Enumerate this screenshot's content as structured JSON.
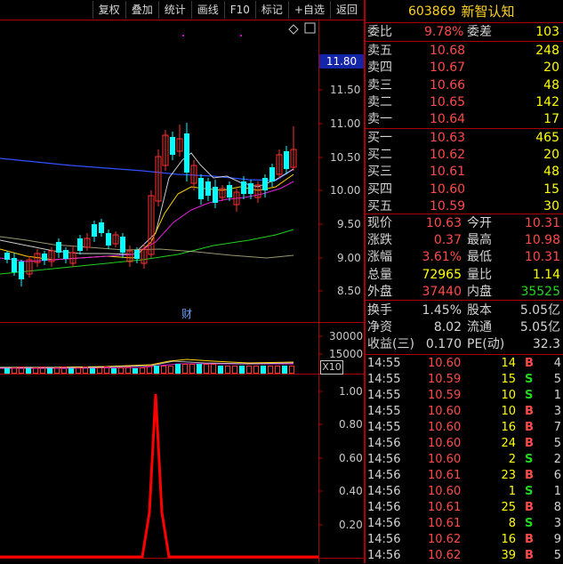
{
  "toolbar": {
    "buttons": [
      "复权",
      "叠加",
      "统计",
      "画线",
      "F10",
      "标记",
      "+自选",
      "返回"
    ]
  },
  "stock": {
    "code": "603869",
    "name": "新智认知"
  },
  "orderbook": {
    "weibi_label": "委比",
    "weibi": "9.78%",
    "weicha_label": "委差",
    "weicha": "103",
    "asks": [
      {
        "label": "卖五",
        "price": "10.68",
        "vol": "248"
      },
      {
        "label": "卖四",
        "price": "10.67",
        "vol": "20"
      },
      {
        "label": "卖三",
        "price": "10.66",
        "vol": "48"
      },
      {
        "label": "卖二",
        "price": "10.65",
        "vol": "142"
      },
      {
        "label": "卖一",
        "price": "10.64",
        "vol": "17"
      }
    ],
    "bids": [
      {
        "label": "买一",
        "price": "10.63",
        "vol": "465"
      },
      {
        "label": "买二",
        "price": "10.62",
        "vol": "20"
      },
      {
        "label": "买三",
        "price": "10.61",
        "vol": "48"
      },
      {
        "label": "买四",
        "price": "10.60",
        "vol": "15"
      },
      {
        "label": "买五",
        "price": "10.59",
        "vol": "30"
      }
    ]
  },
  "quote": [
    {
      "l1": "现价",
      "v1": "10.63",
      "l2": "今开",
      "v2": "10.31",
      "c1": "red",
      "c2": "red"
    },
    {
      "l1": "涨跌",
      "v1": "0.37",
      "l2": "最高",
      "v2": "10.98",
      "c1": "red",
      "c2": "red"
    },
    {
      "l1": "涨幅",
      "v1": "3.61%",
      "l2": "最低",
      "v2": "10.31",
      "c1": "red",
      "c2": "red"
    },
    {
      "l1": "总量",
      "v1": "72965",
      "l2": "量比",
      "v2": "1.14",
      "c1": "yel",
      "c2": "yel"
    },
    {
      "l1": "外盘",
      "v1": "37440",
      "l2": "内盘",
      "v2": "35525",
      "c1": "red",
      "c2": "grn"
    }
  ],
  "fundamentals": [
    {
      "l1": "换手",
      "v1": "1.45%",
      "l2": "股本",
      "v2": "5.05亿"
    },
    {
      "l1": "净资",
      "v1": "8.02",
      "l2": "流通",
      "v2": "5.05亿"
    },
    {
      "l1": "收益(三)",
      "v1": "0.170",
      "l2": "PE(动)",
      "v2": "32.3"
    }
  ],
  "trades": [
    {
      "time": "14:55",
      "price": "10.60",
      "vol": "14",
      "side": "B",
      "n": "4"
    },
    {
      "time": "14:55",
      "price": "10.59",
      "vol": "15",
      "side": "S",
      "n": "5"
    },
    {
      "time": "14:55",
      "price": "10.59",
      "vol": "10",
      "side": "S",
      "n": "1"
    },
    {
      "time": "14:55",
      "price": "10.60",
      "vol": "10",
      "side": "B",
      "n": "3"
    },
    {
      "time": "14:55",
      "price": "10.60",
      "vol": "16",
      "side": "B",
      "n": "7"
    },
    {
      "time": "14:56",
      "price": "10.60",
      "vol": "24",
      "side": "B",
      "n": "5"
    },
    {
      "time": "14:56",
      "price": "10.60",
      "vol": "2",
      "side": "S",
      "n": "2"
    },
    {
      "time": "14:56",
      "price": "10.61",
      "vol": "23",
      "side": "B",
      "n": "6"
    },
    {
      "time": "14:56",
      "price": "10.60",
      "vol": "1",
      "side": "S",
      "n": "1"
    },
    {
      "time": "14:56",
      "price": "10.61",
      "vol": "25",
      "side": "B",
      "n": "8"
    },
    {
      "time": "14:56",
      "price": "10.61",
      "vol": "8",
      "side": "S",
      "n": "3"
    },
    {
      "time": "14:56",
      "price": "10.62",
      "vol": "16",
      "side": "B",
      "n": "9"
    },
    {
      "time": "14:56",
      "price": "10.62",
      "vol": "39",
      "side": "B",
      "n": "5"
    }
  ],
  "main_chart": {
    "price_badge": "11.80",
    "yticks": [
      "11.50",
      "11.00",
      "10.50",
      "10.00",
      "9.50",
      "9.00",
      "8.50"
    ],
    "marker": "财"
  },
  "volume_chart": {
    "yticks": [
      "30000",
      "15000"
    ],
    "unit": "X10"
  },
  "indicator_chart": {
    "yticks": [
      "1.00",
      "0.80",
      "0.60",
      "0.40",
      "0.20"
    ]
  }
}
